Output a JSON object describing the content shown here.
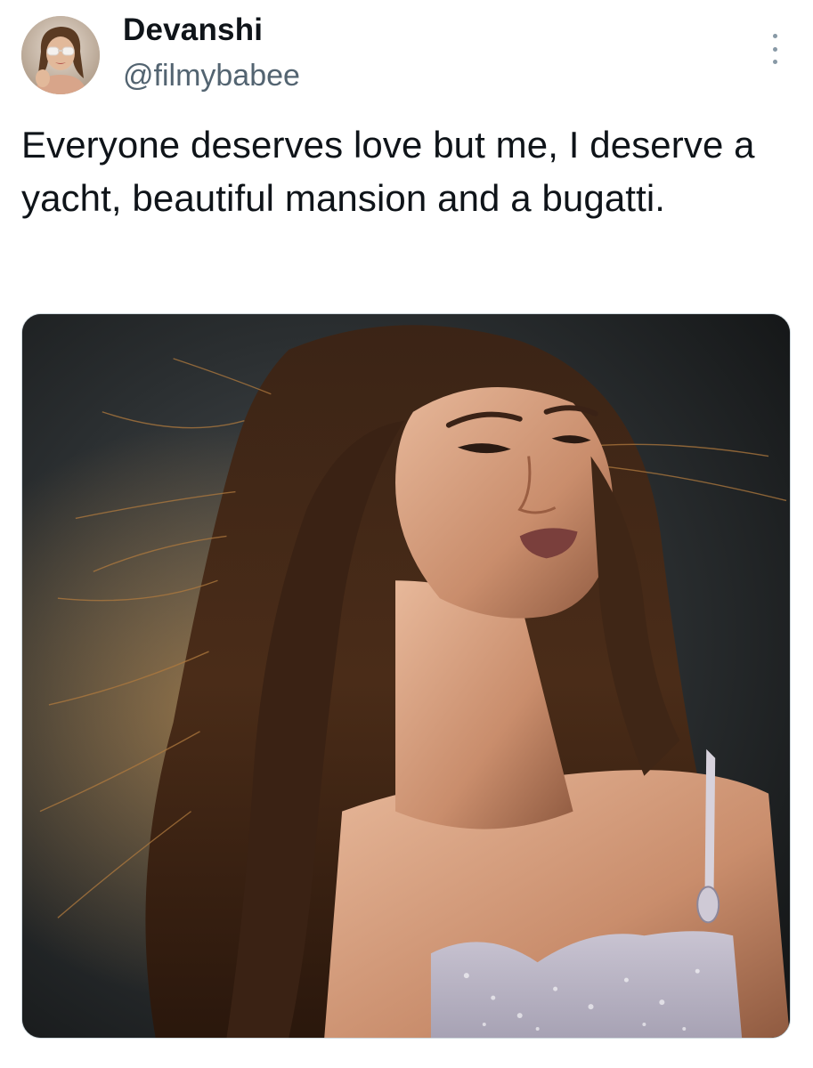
{
  "tweet": {
    "author": {
      "display_name": "Devanshi",
      "handle": "@filmybabee",
      "avatar_icon": "profile-photo"
    },
    "more_icon": "more-vertical-icon",
    "text": "Everyone deserves love but me, I deserve a yacht, beautiful mansion and a bugatti.",
    "media": {
      "type": "photo",
      "subject": "woman-portrait"
    }
  },
  "colors": {
    "text_primary": "#0f1419",
    "text_secondary": "#536471",
    "background": "#ffffff"
  }
}
